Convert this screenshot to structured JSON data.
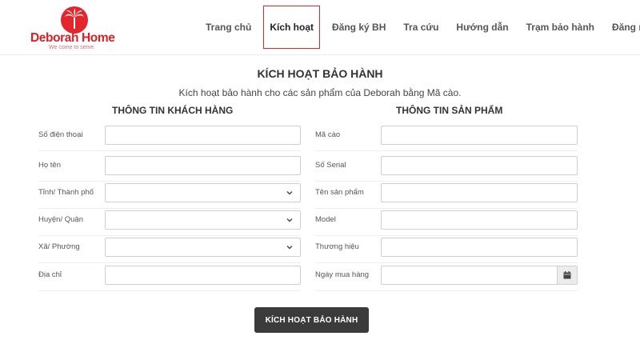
{
  "brand": {
    "name_part1": "Deborah",
    "name_part2": "Home",
    "slogan": "We come to serve",
    "color": "#e3262e"
  },
  "nav": {
    "items": [
      {
        "label": "Trang chủ",
        "active": false
      },
      {
        "label": "Kích hoạt",
        "active": true
      },
      {
        "label": "Đăng ký BH",
        "active": false
      },
      {
        "label": "Tra cứu",
        "active": false
      },
      {
        "label": "Hướng dẫn",
        "active": false
      },
      {
        "label": "Trạm bảo hành",
        "active": false
      },
      {
        "label": "Đăng nhập",
        "active": false
      }
    ]
  },
  "page": {
    "title": "KÍCH HOẠT BẢO HÀNH",
    "subtitle": "Kích hoạt bảo hành cho các sản phẩm của Deborah bằng Mã cào."
  },
  "customer": {
    "heading": "THÔNG TIN KHÁCH HÀNG",
    "fields": [
      {
        "label": "Số điện thoại",
        "type": "text",
        "value": ""
      },
      {
        "label": "Họ tên",
        "type": "text",
        "value": ""
      },
      {
        "label": "Tỉnh/ Thành phố",
        "type": "select",
        "value": ""
      },
      {
        "label": "Huyện/ Quận",
        "type": "select",
        "value": ""
      },
      {
        "label": "Xã/ Phường",
        "type": "select",
        "value": ""
      },
      {
        "label": "Địa chỉ",
        "type": "text",
        "value": ""
      }
    ]
  },
  "product": {
    "heading": "THÔNG TIN SẢN PHẨM",
    "fields": [
      {
        "label": "Mã cào",
        "type": "text",
        "value": ""
      },
      {
        "label": "Số Serial",
        "type": "text",
        "value": ""
      },
      {
        "label": "Tên sản phẩm",
        "type": "text",
        "value": ""
      },
      {
        "label": "Model",
        "type": "text",
        "value": ""
      },
      {
        "label": "Thương hiệu",
        "type": "text",
        "value": ""
      },
      {
        "label": "Ngày mua hàng",
        "type": "date",
        "value": ""
      }
    ]
  },
  "actions": {
    "submit_label": "KÍCH HOẠT BẢO HÀNH"
  }
}
